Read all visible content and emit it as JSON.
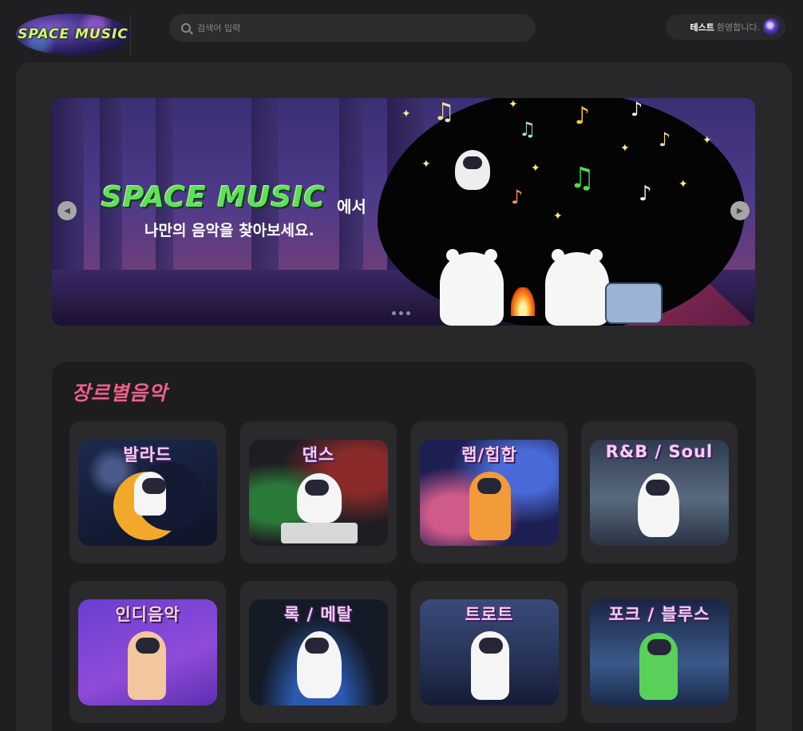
{
  "header": {
    "logo_text": "SPACE MUSIC",
    "search_placeholder": "검색어 입력",
    "user_name": "테스트",
    "user_welcome": "환영합니다."
  },
  "banner": {
    "title": "SPACE MUSIC",
    "title_suffix": "에서",
    "subtitle": "나만의 음악을 찾아보세요.",
    "prev_icon": "◀",
    "next_icon": "▶",
    "slide_count": 3
  },
  "genres": {
    "heading": "장르별음악",
    "items": [
      {
        "label": "발라드"
      },
      {
        "label": "댄스"
      },
      {
        "label": "랩/힙합"
      },
      {
        "label": "R&B / Soul"
      },
      {
        "label": "인디음악"
      },
      {
        "label": "록 / 메탈"
      },
      {
        "label": "트로트"
      },
      {
        "label": "포크 / 블루스"
      }
    ]
  },
  "colors": {
    "accent_pink": "#ee5f87",
    "logo_green": "#d9f56a",
    "banner_green": "#5fe05a"
  }
}
